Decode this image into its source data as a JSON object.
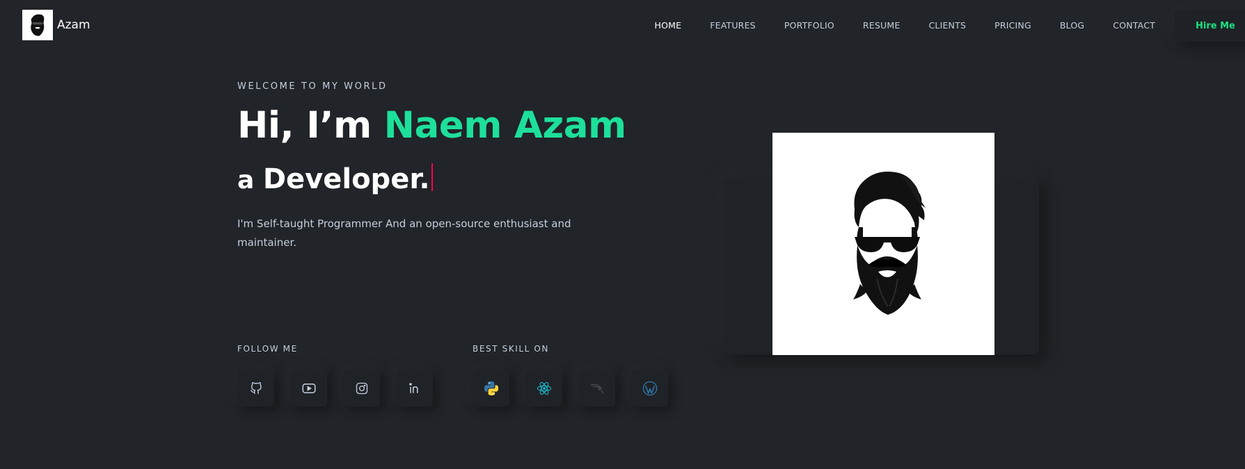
{
  "header": {
    "logo_text": "Azam",
    "nav": [
      {
        "label": "HOME",
        "active": true
      },
      {
        "label": "FEATURES"
      },
      {
        "label": "PORTFOLIO"
      },
      {
        "label": "RESUME"
      },
      {
        "label": "CLIENTS"
      },
      {
        "label": "PRICING"
      },
      {
        "label": "BLOG"
      },
      {
        "label": "CONTACT"
      }
    ],
    "hire_label": "Hire Me"
  },
  "hero": {
    "welcome": "WELCOME TO MY WORLD",
    "greeting": "Hi, I’m ",
    "name": "Naem Azam",
    "role_prefix": "a ",
    "role": "Developer.",
    "description": "I'm Self-taught Programmer And an open-source enthusiast and maintainer."
  },
  "follow": {
    "label": "FOLLOW ME",
    "icons": [
      "github-icon",
      "youtube-icon",
      "instagram-icon",
      "linkedin-icon"
    ]
  },
  "skills": {
    "label": "BEST SKILL ON",
    "icons": [
      "python-icon",
      "react-icon",
      "kali-linux-icon",
      "wordpress-icon"
    ]
  },
  "colors": {
    "background": "#212428",
    "accent_green": "#1de09b",
    "hire_green": "#1de080",
    "cursor_red": "#ff014f",
    "text": "#c4cfde"
  }
}
